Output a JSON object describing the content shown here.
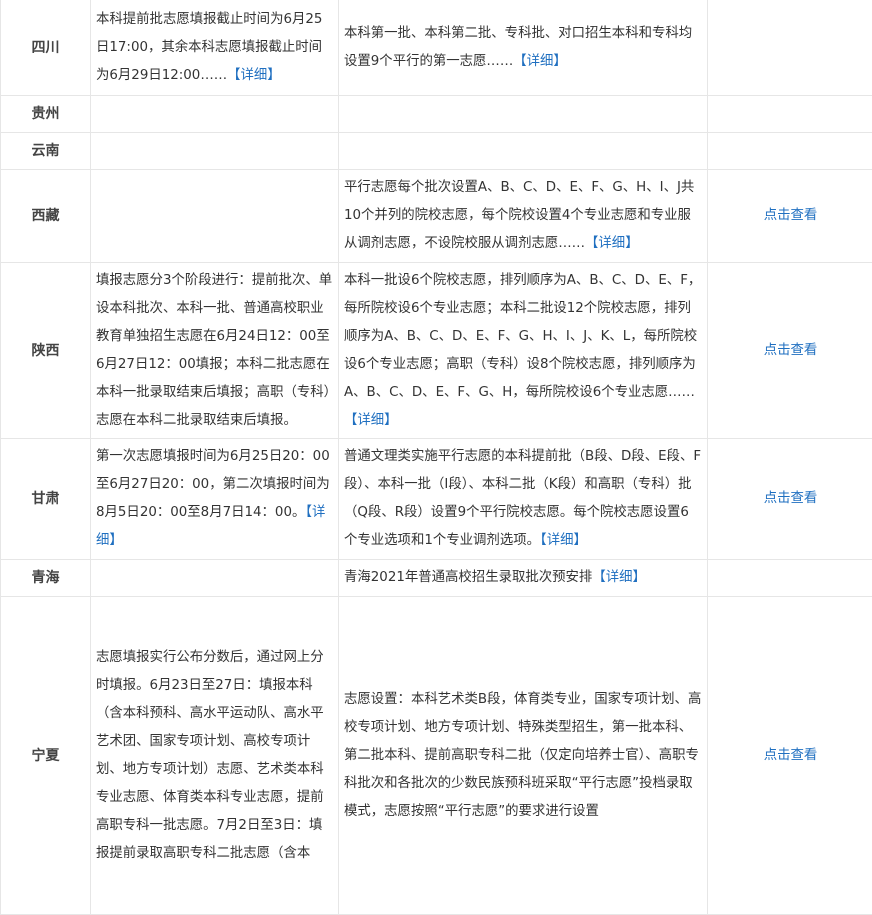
{
  "rows": [
    {
      "province": "四川",
      "time": "本科提前批志愿填报截止时间为6月25日17:00，其余本科志愿填报截止时间为6月29日12:00……",
      "time_more": "【详细】",
      "rule": "本科第一批、本科第二批、专科批、对口招生本科和专科均设置9个平行的第一志愿……",
      "rule_more": "【详细】",
      "action": ""
    },
    {
      "province": "贵州",
      "time": "",
      "time_more": "",
      "rule": "",
      "rule_more": "",
      "action": ""
    },
    {
      "province": "云南",
      "time": "",
      "time_more": "",
      "rule": "",
      "rule_more": "",
      "action": ""
    },
    {
      "province": "西藏",
      "time": "",
      "time_more": "",
      "rule": "平行志愿每个批次设置A、B、C、D、E、F、G、H、I、J共10个并列的院校志愿，每个院校设置4个专业志愿和专业服从调剂志愿，不设院校服从调剂志愿……",
      "rule_more": "【详细】",
      "action": "点击查看"
    },
    {
      "province": "陕西",
      "time": "填报志愿分3个阶段进行：提前批次、单设本科批次、本科一批、普通高校职业教育单独招生志愿在6月24日12：00至6月27日12：00填报；本科二批志愿在本科一批录取结束后填报；高职（专科）志愿在本科二批录取结束后填报。",
      "time_more": "",
      "rule": "本科一批设6个院校志愿，排列顺序为A、B、C、D、E、F，每所院校设6个专业志愿；本科二批设12个院校志愿，排列顺序为A、B、C、D、E、F、G、H、I、J、K、L，每所院校设6个专业志愿；高职（专科）设8个院校志愿，排列顺序为A、B、C、D、E、F、G、H，每所院校设6个专业志愿……",
      "rule_more": "【详细】",
      "action": "点击查看"
    },
    {
      "province": "甘肃",
      "time": "第一次志愿填报时间为6月25日20：00至6月27日20：00，第二次填报时间为8月5日20：00至8月7日14：00。",
      "time_more": "【详细】",
      "rule": "普通文理类实施平行志愿的本科提前批（B段、D段、E段、F段）、本科一批（I段）、本科二批（K段）和高职（专科）批（Q段、R段）设置9个平行院校志愿。每个院校志愿设置6个专业选项和1个专业调剂选项。",
      "rule_more": "【详细】",
      "action": "点击查看"
    },
    {
      "province": "青海",
      "time": "",
      "time_more": "",
      "rule": "青海2021年普通高校招生录取批次预安排",
      "rule_more": "【详细】",
      "action": ""
    },
    {
      "province": "宁夏",
      "time": "志愿填报实行公布分数后，通过网上分时填报。6月23日至27日：填报本科（含本科预科、高水平运动队、高水平艺术团、国家专项计划、高校专项计划、地方专项计划）志愿、艺术类本科专业志愿、体育类本科专业志愿，提前高职专科一批志愿。7月2日至3日：填报提前录取高职专科二批志愿（含本",
      "time_more": "",
      "rule": "志愿设置：本科艺术类B段，体育类专业，国家专项计划、高校专项计划、地方专项计划、特殊类型招生，第一批本科、第二批本科、提前高职专科二批（仅定向培养士官）、高职专科批次和各批次的少数民族预科班采取“平行志愿”投档录取模式，志愿按照“平行志愿”的要求进行设置",
      "rule_more": "",
      "action": "点击查看"
    }
  ]
}
